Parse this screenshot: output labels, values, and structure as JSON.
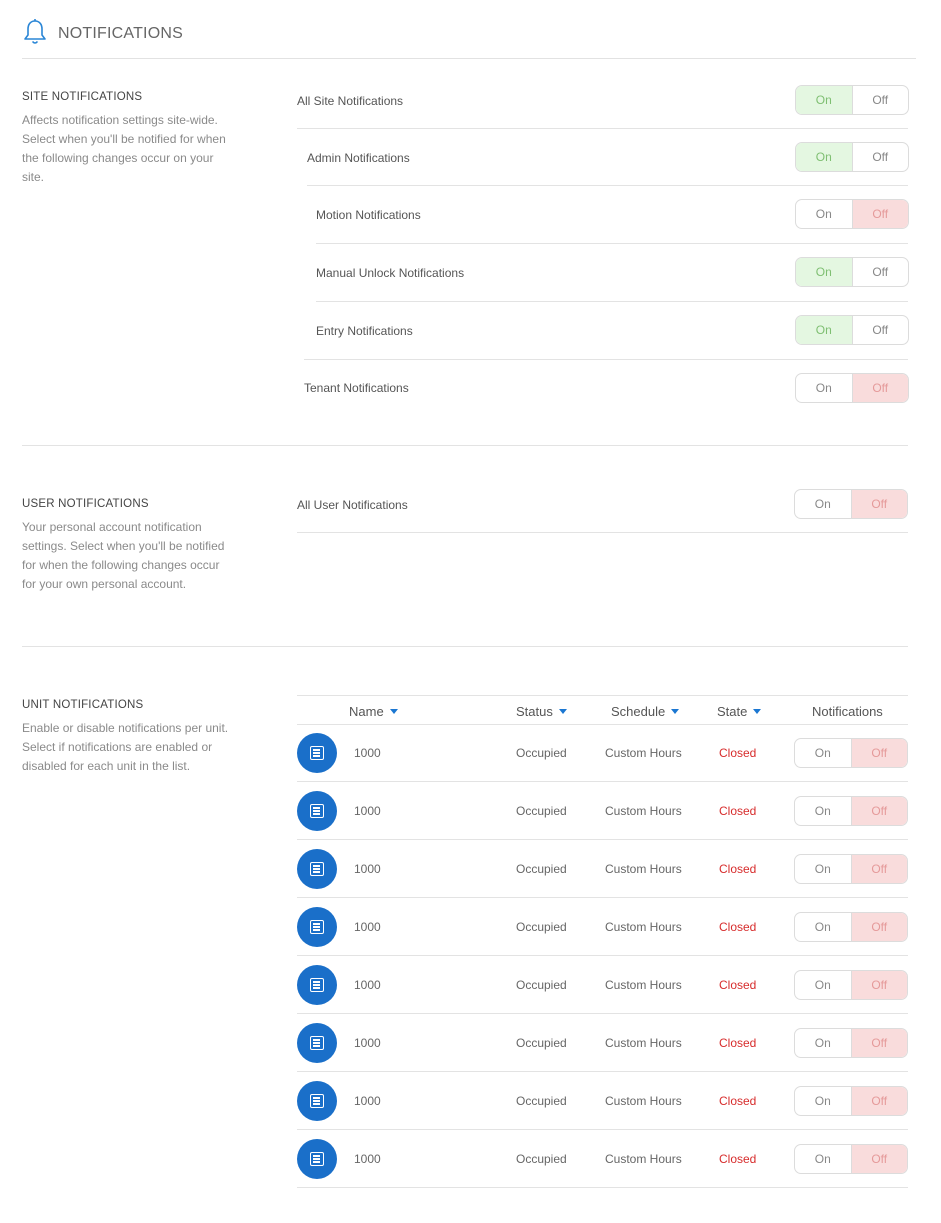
{
  "page": {
    "title": "NOTIFICATIONS",
    "icon": "bell-icon"
  },
  "site": {
    "title": "SITE NOTIFICATIONS",
    "desc_lines": [
      "Affects notification settings site-wide.",
      "Select when you'll be notified for when",
      "the following changes occur on your",
      "site."
    ],
    "rows": [
      {
        "label": "All Site Notifications",
        "state": "On"
      },
      {
        "label": "Admin Notifications",
        "state": "On"
      },
      {
        "label": "Motion Notifications",
        "state": "Off"
      },
      {
        "label": "Manual Unlock Notifications",
        "state": "On"
      },
      {
        "label": "Entry Notifications",
        "state": "On"
      },
      {
        "label": "Tenant Notifications",
        "state": "Off"
      }
    ]
  },
  "user": {
    "title": "USER NOTIFICATIONS",
    "desc_lines": [
      "Your personal account notification",
      "settings. Select when you'll be notified",
      "for when the following changes occur",
      "for your own personal account."
    ],
    "rows": [
      {
        "label": "All User Notifications",
        "state": "Off"
      }
    ]
  },
  "unit": {
    "title": "UNIT NOTIFICATIONS",
    "desc_lines": [
      "Enable or disable notifications per unit.",
      "Select if notifications are enabled or",
      "disabled for each unit in the list."
    ],
    "columns": {
      "name": "Name",
      "status": "Status",
      "schedule": "Schedule",
      "state": "State",
      "notifications": "Notifications"
    },
    "rows": [
      {
        "name": "1000",
        "status": "Occupied",
        "schedule": "Custom Hours",
        "state": "Closed",
        "notifications": "Off"
      },
      {
        "name": "1000",
        "status": "Occupied",
        "schedule": "Custom Hours",
        "state": "Closed",
        "notifications": "Off"
      },
      {
        "name": "1000",
        "status": "Occupied",
        "schedule": "Custom Hours",
        "state": "Closed",
        "notifications": "Off"
      },
      {
        "name": "1000",
        "status": "Occupied",
        "schedule": "Custom Hours",
        "state": "Closed",
        "notifications": "Off"
      },
      {
        "name": "1000",
        "status": "Occupied",
        "schedule": "Custom Hours",
        "state": "Closed",
        "notifications": "Off"
      },
      {
        "name": "1000",
        "status": "Occupied",
        "schedule": "Custom Hours",
        "state": "Closed",
        "notifications": "Off"
      },
      {
        "name": "1000",
        "status": "Occupied",
        "schedule": "Custom Hours",
        "state": "Closed",
        "notifications": "Off"
      },
      {
        "name": "1000",
        "status": "Occupied",
        "schedule": "Custom Hours",
        "state": "Closed",
        "notifications": "Off"
      }
    ]
  },
  "toggle": {
    "on_label": "On",
    "off_label": "Off"
  },
  "colors": {
    "on_bg": "#e4f7e1",
    "on_text": "#7fbf72",
    "off_bg": "#f9dcdc",
    "off_text": "#e59a9a",
    "closed": "#d72c2c",
    "accent": "#1a6fc9"
  }
}
